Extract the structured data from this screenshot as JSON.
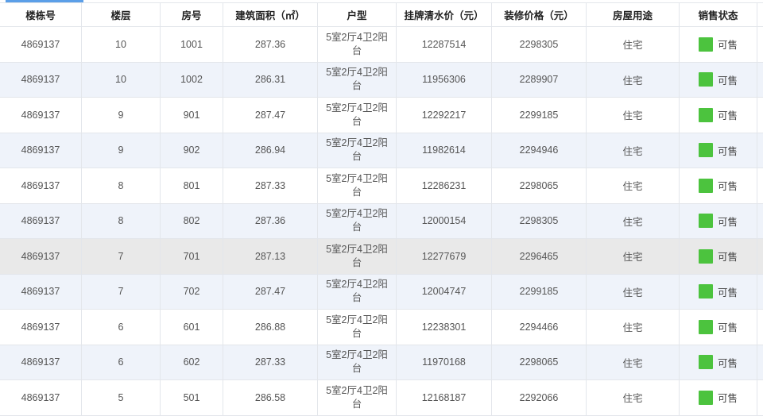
{
  "table": {
    "columns": [
      "楼栋号",
      "楼层",
      "房号",
      "建筑面积（㎡）",
      "户型",
      "挂牌清水价（元）",
      "装修价格（元）",
      "房屋用途",
      "销售状态"
    ],
    "rows": [
      {
        "building": "4869137",
        "floor": "10",
        "room": "1001",
        "area": "287.36",
        "layout": "5室2厅4卫2阳台",
        "list_price": "12287514",
        "decor_price": "2298305",
        "usage": "住宅",
        "status": "可售"
      },
      {
        "building": "4869137",
        "floor": "10",
        "room": "1002",
        "area": "286.31",
        "layout": "5室2厅4卫2阳台",
        "list_price": "11956306",
        "decor_price": "2289907",
        "usage": "住宅",
        "status": "可售"
      },
      {
        "building": "4869137",
        "floor": "9",
        "room": "901",
        "area": "287.47",
        "layout": "5室2厅4卫2阳台",
        "list_price": "12292217",
        "decor_price": "2299185",
        "usage": "住宅",
        "status": "可售"
      },
      {
        "building": "4869137",
        "floor": "9",
        "room": "902",
        "area": "286.94",
        "layout": "5室2厅4卫2阳台",
        "list_price": "11982614",
        "decor_price": "2294946",
        "usage": "住宅",
        "status": "可售"
      },
      {
        "building": "4869137",
        "floor": "8",
        "room": "801",
        "area": "287.33",
        "layout": "5室2厅4卫2阳台",
        "list_price": "12286231",
        "decor_price": "2298065",
        "usage": "住宅",
        "status": "可售"
      },
      {
        "building": "4869137",
        "floor": "8",
        "room": "802",
        "area": "287.36",
        "layout": "5室2厅4卫2阳台",
        "list_price": "12000154",
        "decor_price": "2298305",
        "usage": "住宅",
        "status": "可售"
      },
      {
        "building": "4869137",
        "floor": "7",
        "room": "701",
        "area": "287.13",
        "layout": "5室2厅4卫2阳台",
        "list_price": "12277679",
        "decor_price": "2296465",
        "usage": "住宅",
        "status": "可售"
      },
      {
        "building": "4869137",
        "floor": "7",
        "room": "702",
        "area": "287.47",
        "layout": "5室2厅4卫2阳台",
        "list_price": "12004747",
        "decor_price": "2299185",
        "usage": "住宅",
        "status": "可售"
      },
      {
        "building": "4869137",
        "floor": "6",
        "room": "601",
        "area": "286.88",
        "layout": "5室2厅4卫2阳台",
        "list_price": "12238301",
        "decor_price": "2294466",
        "usage": "住宅",
        "status": "可售"
      },
      {
        "building": "4869137",
        "floor": "6",
        "room": "602",
        "area": "287.33",
        "layout": "5室2厅4卫2阳台",
        "list_price": "11970168",
        "decor_price": "2298065",
        "usage": "住宅",
        "status": "可售"
      },
      {
        "building": "4869137",
        "floor": "5",
        "room": "501",
        "area": "286.58",
        "layout": "5室2厅4卫2阳台",
        "list_price": "12168187",
        "decor_price": "2292066",
        "usage": "住宅",
        "status": "可售"
      }
    ]
  },
  "colors": {
    "accent": "#5b9fe8",
    "status_available": "#4cc33e",
    "row_alt": "#eff3fa",
    "row_hover": "#e9e9e9"
  },
  "icons": {
    "status": "status-square-icon"
  }
}
